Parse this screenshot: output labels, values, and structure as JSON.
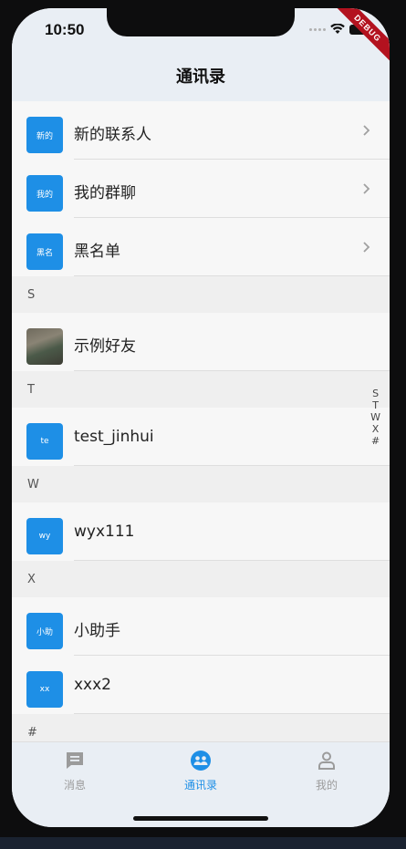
{
  "status": {
    "time": "10:50",
    "debug_label": "DEBUG"
  },
  "appbar": {
    "title": "通讯录"
  },
  "top_items": [
    {
      "avatar_text": "新的",
      "name": "新的联系人"
    },
    {
      "avatar_text": "我的",
      "name": "我的群聊"
    },
    {
      "avatar_text": "黑名",
      "name": "黑名单"
    }
  ],
  "sections": [
    {
      "letter": "S",
      "contacts": [
        {
          "avatar_text": "",
          "name": "示例好友"
        }
      ]
    },
    {
      "letter": "T",
      "contacts": [
        {
          "avatar_text": "te",
          "name": "test_jinhui"
        }
      ]
    },
    {
      "letter": "W",
      "contacts": [
        {
          "avatar_text": "wy",
          "name": "wyx111"
        }
      ]
    },
    {
      "letter": "X",
      "contacts": [
        {
          "avatar_text": "小助",
          "name": "小助手"
        },
        {
          "avatar_text": "xx",
          "name": "xxx2"
        }
      ]
    },
    {
      "letter": "#",
      "contacts": []
    }
  ],
  "index_bar": [
    "S",
    "T",
    "W",
    "X",
    "#"
  ],
  "tabs": [
    {
      "label": "消息",
      "icon": "message-icon",
      "active": false
    },
    {
      "label": "通讯录",
      "icon": "contacts-icon",
      "active": true
    },
    {
      "label": "我的",
      "icon": "person-icon",
      "active": false
    }
  ],
  "colors": {
    "accent": "#1e8fe6",
    "inactive": "#9b9b9b",
    "appbar_bg": "#e9eef4"
  }
}
